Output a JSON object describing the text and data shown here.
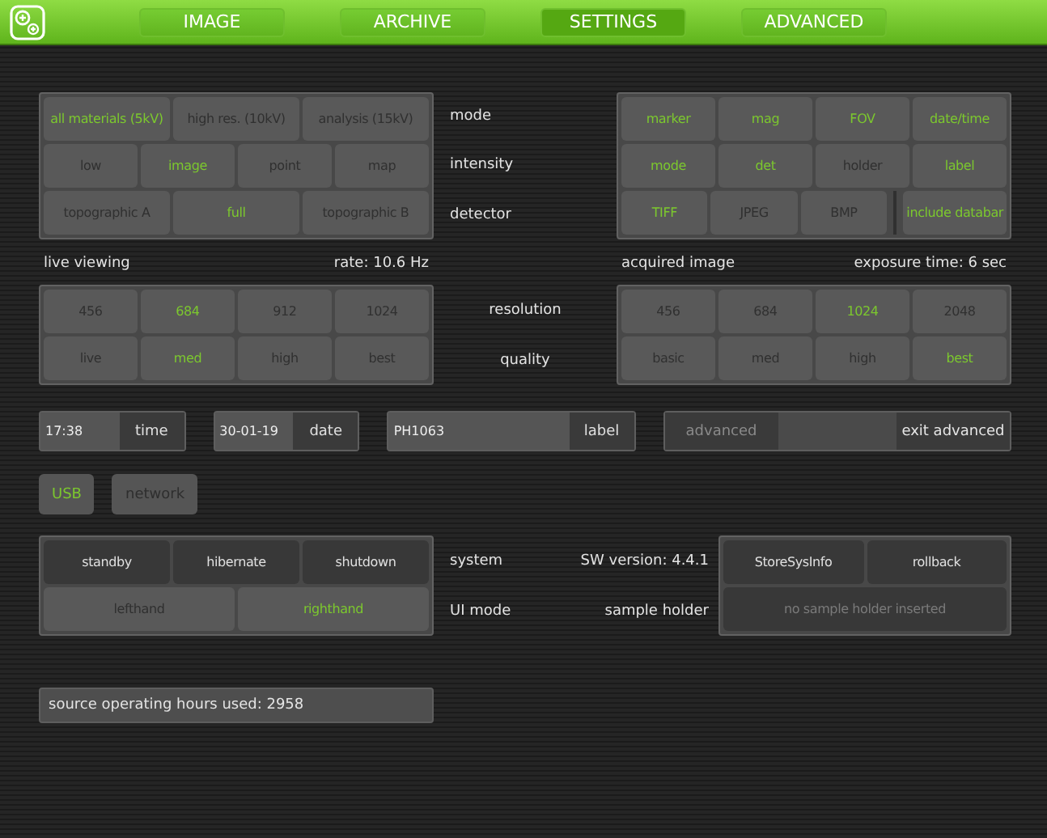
{
  "header": {
    "tabs": [
      {
        "label": "IMAGE",
        "selected": false
      },
      {
        "label": "ARCHIVE",
        "selected": false
      },
      {
        "label": "SETTINGS",
        "selected": true
      },
      {
        "label": "ADVANCED",
        "selected": false
      }
    ]
  },
  "beam_panel": {
    "rows": [
      {
        "options": [
          {
            "label": "all materials (5kV)",
            "selected": true
          },
          {
            "label": "high res. (10kV)",
            "selected": false
          },
          {
            "label": "analysis (15kV)",
            "selected": false
          }
        ]
      },
      {
        "options": [
          {
            "label": "low",
            "selected": false
          },
          {
            "label": "image",
            "selected": true
          },
          {
            "label": "point",
            "selected": false
          },
          {
            "label": "map",
            "selected": false
          }
        ]
      },
      {
        "options": [
          {
            "label": "topographic A",
            "selected": false
          },
          {
            "label": "full",
            "selected": true
          },
          {
            "label": "topographic B",
            "selected": false
          }
        ]
      }
    ]
  },
  "row_labels": [
    "mode",
    "intensity",
    "detector"
  ],
  "display_panel": {
    "rows": [
      {
        "options": [
          {
            "label": "marker",
            "selected": true,
            "kind": "toggle"
          },
          {
            "label": "mag",
            "selected": true,
            "kind": "toggle"
          },
          {
            "label": "FOV",
            "selected": true,
            "kind": "toggle"
          },
          {
            "label": "date/time",
            "selected": true,
            "kind": "toggle"
          }
        ]
      },
      {
        "options": [
          {
            "label": "mode",
            "selected": true,
            "kind": "toggle"
          },
          {
            "label": "det",
            "selected": true,
            "kind": "toggle"
          },
          {
            "label": "holder",
            "selected": false,
            "kind": "toggle"
          },
          {
            "label": "label",
            "selected": true,
            "kind": "toggle"
          }
        ]
      },
      {
        "options": [
          {
            "label": "TIFF",
            "selected": true,
            "kind": "format"
          },
          {
            "label": "JPEG",
            "selected": false,
            "kind": "format"
          },
          {
            "label": "BMP",
            "selected": false,
            "kind": "format"
          },
          {
            "label": "include databar",
            "selected": true,
            "kind": "toggle"
          }
        ]
      }
    ]
  },
  "live_viewing": {
    "title": "live viewing",
    "reading": "rate: 10.6 Hz",
    "rows": [
      {
        "options": [
          {
            "label": "456",
            "selected": false
          },
          {
            "label": "684",
            "selected": true
          },
          {
            "label": "912",
            "selected": false
          },
          {
            "label": "1024",
            "selected": false
          }
        ]
      },
      {
        "options": [
          {
            "label": "live",
            "selected": false
          },
          {
            "label": "med",
            "selected": true
          },
          {
            "label": "high",
            "selected": false
          },
          {
            "label": "best",
            "selected": false
          }
        ]
      }
    ]
  },
  "acquired_image": {
    "title": "acquired image",
    "reading": "exposure time: 6 sec",
    "rows": [
      {
        "options": [
          {
            "label": "456",
            "selected": false
          },
          {
            "label": "684",
            "selected": false
          },
          {
            "label": "1024",
            "selected": true
          },
          {
            "label": "2048",
            "selected": false
          }
        ]
      },
      {
        "options": [
          {
            "label": "basic",
            "selected": false
          },
          {
            "label": "med",
            "selected": false
          },
          {
            "label": "high",
            "selected": false
          },
          {
            "label": "best",
            "selected": true
          }
        ]
      }
    ]
  },
  "image_labels": [
    "resolution",
    "quality"
  ],
  "fields": [
    {
      "value": "17:38",
      "button": "time"
    },
    {
      "value": "30-01-19",
      "button": "date"
    },
    {
      "value": "PH1063",
      "button": "label"
    }
  ],
  "advanced": {
    "button": "advanced",
    "disabled": true,
    "exit": "exit advanced"
  },
  "connections": [
    {
      "label": "USB",
      "selected": true
    },
    {
      "label": "network",
      "selected": false
    }
  ],
  "system": {
    "buttons": [
      "standby",
      "hibernate",
      "shutdown"
    ],
    "hand": [
      {
        "label": "lefthand",
        "selected": false
      },
      {
        "label": "righthand",
        "selected": true
      }
    ],
    "labels": [
      "system",
      "UI mode"
    ],
    "info": [
      "SW version: 4.4.1",
      "sample holder"
    ],
    "actions": [
      "StoreSysInfo",
      "rollback"
    ],
    "sample_status": {
      "text": "no sample holder inserted",
      "disabled": true
    }
  },
  "footer": "source operating hours used: 2958"
}
